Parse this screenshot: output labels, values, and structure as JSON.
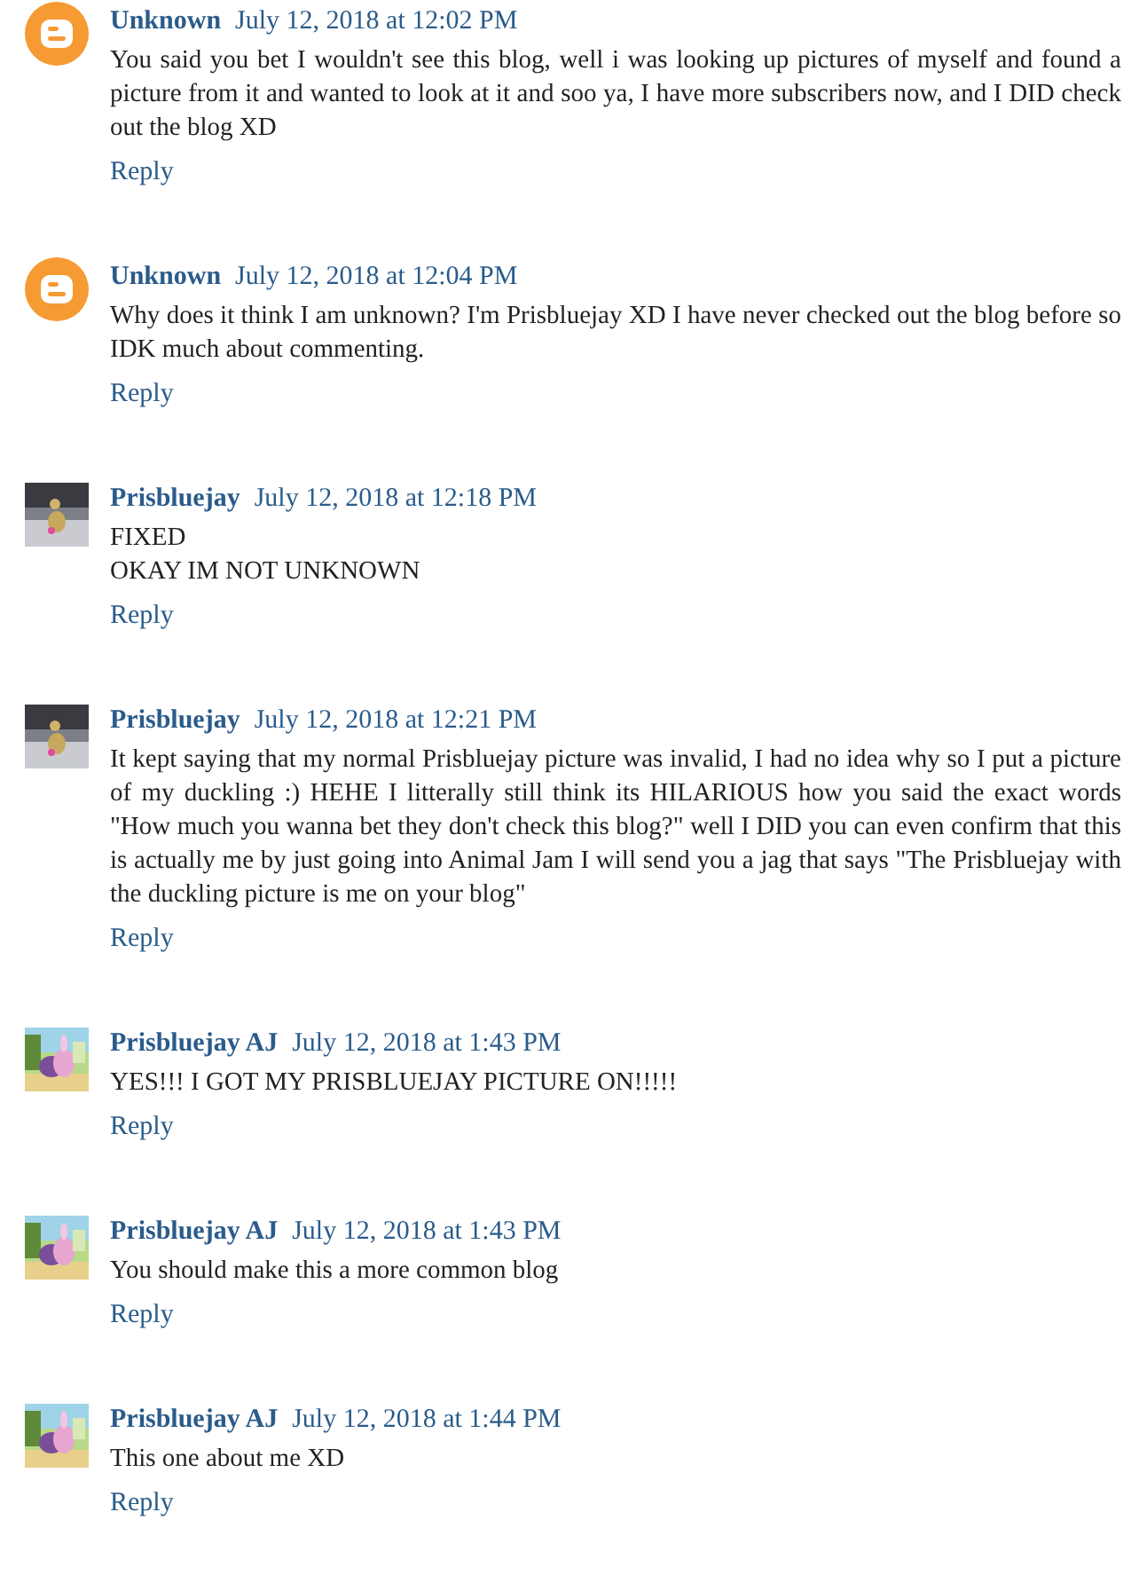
{
  "comments": [
    {
      "avatar": {
        "kind": "blogger"
      },
      "author": "Unknown",
      "date": "July 12, 2018 at 12:02 PM",
      "body": [
        "You said you bet I wouldn't see this blog, well i was looking up pictures of myself and found a picture from it and wanted to look at it and soo ya, I have more subscribers now, and I DID check out the blog XD"
      ],
      "reply": "Reply"
    },
    {
      "avatar": {
        "kind": "blogger"
      },
      "author": "Unknown",
      "date": "July 12, 2018 at 12:04 PM",
      "body": [
        "Why does it think I am unknown? I'm Prisbluejay XD I have never checked out the blog before so IDK much about commenting."
      ],
      "reply": "Reply"
    },
    {
      "avatar": {
        "kind": "picture"
      },
      "author": "Prisbluejay",
      "date": "July 12, 2018 at 12:18 PM",
      "body": [
        "FIXED",
        "OKAY IM NOT UNKNOWN"
      ],
      "reply": "Reply"
    },
    {
      "avatar": {
        "kind": "picture"
      },
      "author": "Prisbluejay",
      "date": "July 12, 2018 at 12:21 PM",
      "body": [
        "It kept saying that my normal Prisbluejay picture was invalid, I had no idea why so I put a picture of my duckling :) HEHE I litterally still think its HILARIOUS how you said the exact words \"How much you wanna bet they don't check this blog?\" well I DID you can even confirm that this is actually me by just going into Animal Jam I will send you a jag that says \"The Prisbluejay with the duckling picture is me on your blog\""
      ],
      "reply": "Reply"
    },
    {
      "avatar": {
        "kind": "picture"
      },
      "author": "Prisbluejay AJ",
      "date": "July 12, 2018 at 1:43 PM",
      "body": [
        "YES!!! I GOT MY PRISBLUEJAY PICTURE ON!!!!!"
      ],
      "reply": "Reply"
    },
    {
      "avatar": {
        "kind": "picture"
      },
      "author": "Prisbluejay AJ",
      "date": "July 12, 2018 at 1:43 PM",
      "body": [
        "You should make this a more common blog"
      ],
      "reply": "Reply"
    },
    {
      "avatar": {
        "kind": "picture"
      },
      "author": "Prisbluejay AJ",
      "date": "July 12, 2018 at 1:44 PM",
      "body": [
        "This one about me XD"
      ],
      "reply": "Reply"
    }
  ]
}
